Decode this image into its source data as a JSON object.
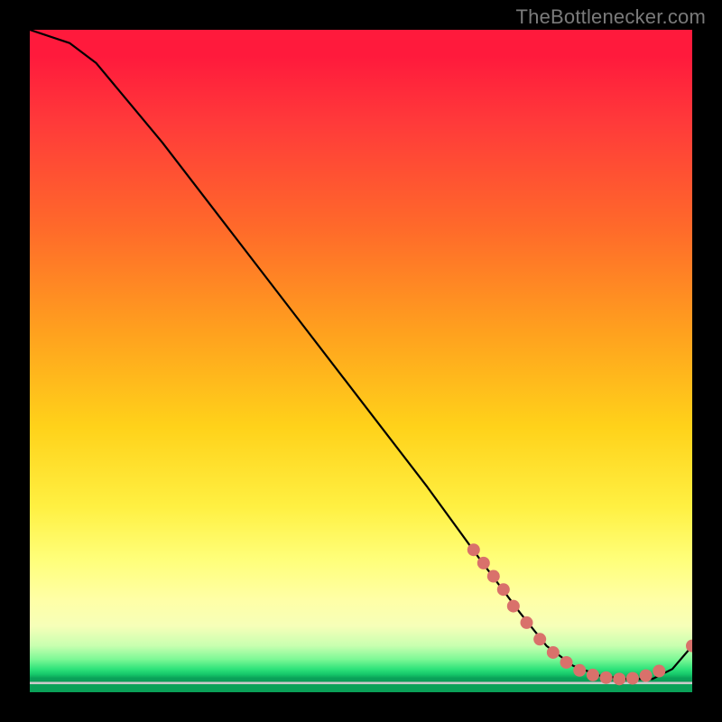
{
  "watermark": {
    "text": "TheBottlenecker.com"
  },
  "chart_data": {
    "type": "line",
    "title": "",
    "xlabel": "",
    "ylabel": "",
    "xlim": [
      0,
      100
    ],
    "ylim": [
      0,
      100
    ],
    "grid": false,
    "series": [
      {
        "name": "curve",
        "x": [
          0,
          6,
          10,
          20,
          30,
          40,
          50,
          60,
          68,
          74,
          78,
          82,
          86,
          90,
          94,
          97,
          100
        ],
        "y": [
          100,
          98,
          95,
          83,
          70,
          57,
          44,
          31,
          20,
          12,
          7,
          4,
          2.5,
          2,
          2,
          3.5,
          7
        ],
        "color": "#000000"
      }
    ],
    "markers": [
      {
        "x": 67.0,
        "y": 21.5
      },
      {
        "x": 68.5,
        "y": 19.5
      },
      {
        "x": 70.0,
        "y": 17.5
      },
      {
        "x": 71.5,
        "y": 15.5
      },
      {
        "x": 73.0,
        "y": 13.0
      },
      {
        "x": 75.0,
        "y": 10.5
      },
      {
        "x": 77.0,
        "y": 8.0
      },
      {
        "x": 79.0,
        "y": 6.0
      },
      {
        "x": 81.0,
        "y": 4.5
      },
      {
        "x": 83.0,
        "y": 3.3
      },
      {
        "x": 85.0,
        "y": 2.6
      },
      {
        "x": 87.0,
        "y": 2.2
      },
      {
        "x": 89.0,
        "y": 2.0
      },
      {
        "x": 91.0,
        "y": 2.1
      },
      {
        "x": 93.0,
        "y": 2.5
      },
      {
        "x": 95.0,
        "y": 3.2
      },
      {
        "x": 100.0,
        "y": 7.0
      }
    ],
    "marker_style": {
      "color": "#d9716b",
      "radius_px": 7
    },
    "background_gradient": {
      "top": "#ff1a3c",
      "mid_upper": "#ffa21e",
      "mid": "#fff042",
      "lower": "#ffffa6",
      "band": "#2fe37a",
      "bottom": "#0aa158"
    }
  }
}
